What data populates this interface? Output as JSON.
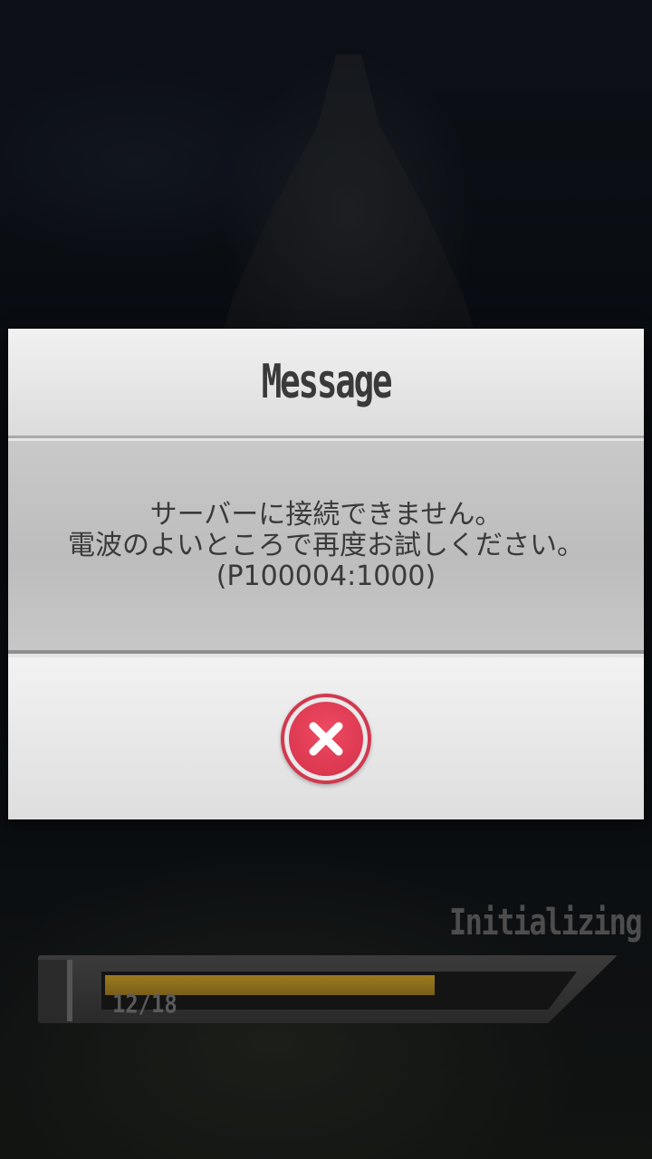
{
  "dialog": {
    "title": "Message",
    "message_lines": [
      "サーバーに接続できません。",
      "電波のよいところで再度お試しください。",
      "(P100004:1000)"
    ],
    "close_icon": "close-x-icon"
  },
  "loading": {
    "label": "Initializing",
    "progress_text": "12/18",
    "progress_fraction": 0.667
  },
  "colors": {
    "accent_red": "#d4314a",
    "progress_fill": "#9c7a1e"
  }
}
